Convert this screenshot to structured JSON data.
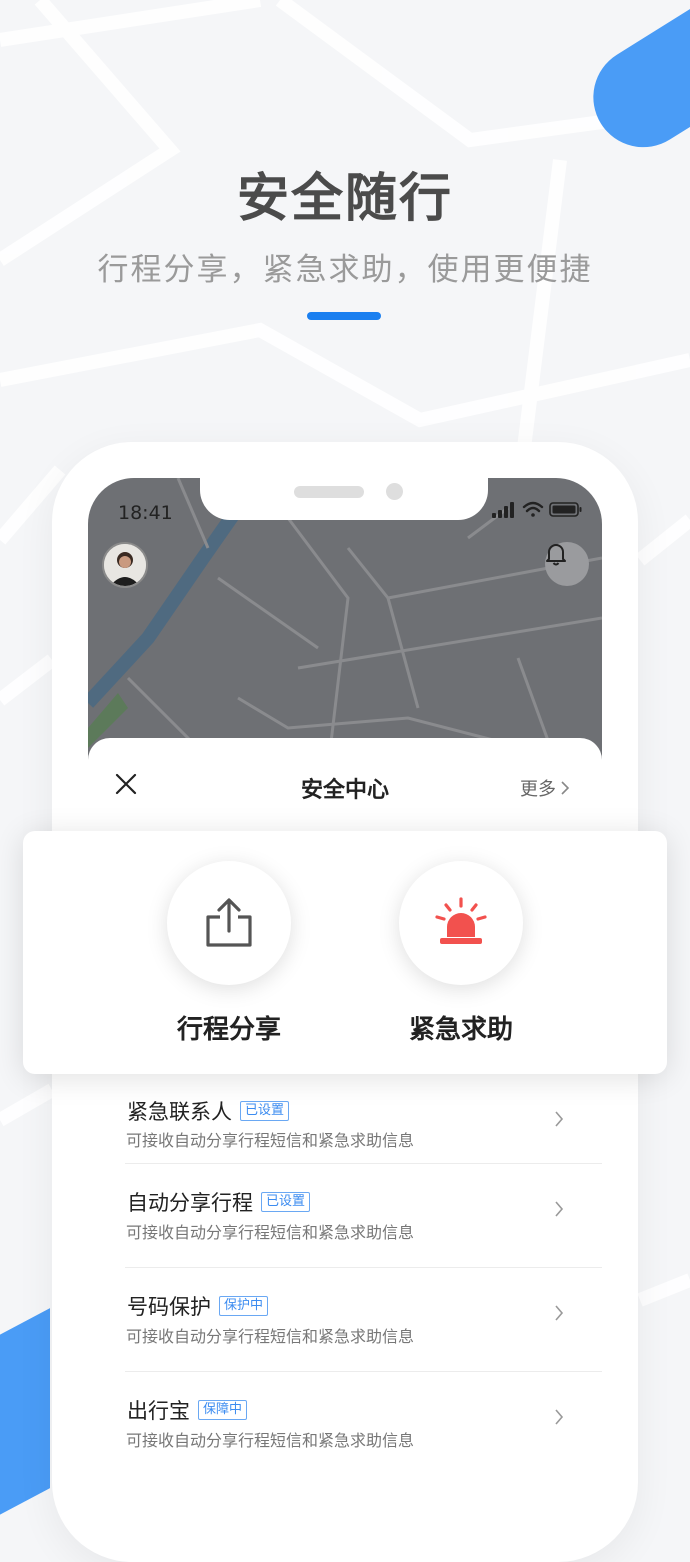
{
  "hero": {
    "title": "安全随行",
    "subtitle": "行程分享，紧急求助，使用更便捷"
  },
  "status_bar": {
    "time": "18:41"
  },
  "sheet": {
    "title": "安全中心",
    "more": "更多"
  },
  "actions": [
    {
      "label": "行程分享",
      "icon": "share-icon"
    },
    {
      "label": "紧急求助",
      "icon": "alarm-icon"
    }
  ],
  "list": [
    {
      "title": "紧急联系人",
      "badge": "已设置",
      "desc": "可接收自动分享行程短信和紧急求助信息"
    },
    {
      "title": "自动分享行程",
      "badge": "已设置",
      "desc": "可接收自动分享行程短信和紧急求助信息"
    },
    {
      "title": "号码保护",
      "badge": "保护中",
      "desc": "可接收自动分享行程短信和紧急求助信息"
    },
    {
      "title": "出行宝",
      "badge": "保障中",
      "desc": "可接收自动分享行程短信和紧急求助信息"
    }
  ],
  "colors": {
    "accent": "#1a7ff0",
    "alarm": "#f2514e",
    "badge": "#3c8cf0"
  }
}
